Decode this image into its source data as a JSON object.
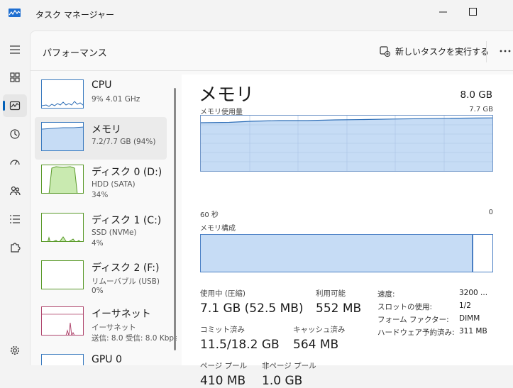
{
  "window": {
    "title": "タスク マネージャー"
  },
  "header": {
    "section_title": "パフォーマンス",
    "run_task_label": "新しいタスクを実行する"
  },
  "perf_list": [
    {
      "name": "CPU",
      "line1": "9%  4.01 GHz",
      "line2": ""
    },
    {
      "name": "メモリ",
      "line1": "7.2/7.7 GB (94%)",
      "line2": ""
    },
    {
      "name": "ディスク 0 (D:)",
      "line1": "HDD (SATA)",
      "line2": "34%"
    },
    {
      "name": "ディスク 1 (C:)",
      "line1": "SSD (NVMe)",
      "line2": "4%"
    },
    {
      "name": "ディスク 2 (F:)",
      "line1": "リムーバブル (USB)",
      "line2": "0%"
    },
    {
      "name": "イーサネット",
      "line1": "イーサネット",
      "line2": "送信: 8.0  受信: 8.0 Kbps"
    },
    {
      "name": "GPU 0",
      "line1": "",
      "line2": ""
    }
  ],
  "detail": {
    "title": "メモリ",
    "total": "8.0 GB",
    "usage_label": "メモリ使用量",
    "usage_max": "7.7 GB",
    "time_left": "60 秒",
    "time_right": "0",
    "composition_label": "メモリ構成",
    "composition_used_fraction": 0.935,
    "stats": {
      "in_use_label": "使用中 (圧縮)",
      "in_use_value": "7.1 GB (52.5 MB)",
      "available_label": "利用可能",
      "available_value": "552 MB",
      "committed_label": "コミット済み",
      "committed_value": "11.5/18.2 GB",
      "cached_label": "キャッシュ済み",
      "cached_value": "564 MB",
      "paged_label": "ページ プール",
      "paged_value": "410 MB",
      "nonpaged_label": "非ページ プール",
      "nonpaged_value": "1.0 GB"
    },
    "specs": [
      {
        "label": "速度:",
        "value": "3200 ..."
      },
      {
        "label": "スロットの使用:",
        "value": "1/2"
      },
      {
        "label": "フォーム ファクター:",
        "value": "DIMM"
      },
      {
        "label": "ハードウェア予約済み:",
        "value": "311 MB"
      }
    ]
  },
  "colors": {
    "memory_fill": "#c6dcf5",
    "memory_line": "#2f6fb7",
    "disk_fill": "#c9eab0",
    "disk_line": "#5a9a2a",
    "ethernet_line": "#b0476e"
  }
}
